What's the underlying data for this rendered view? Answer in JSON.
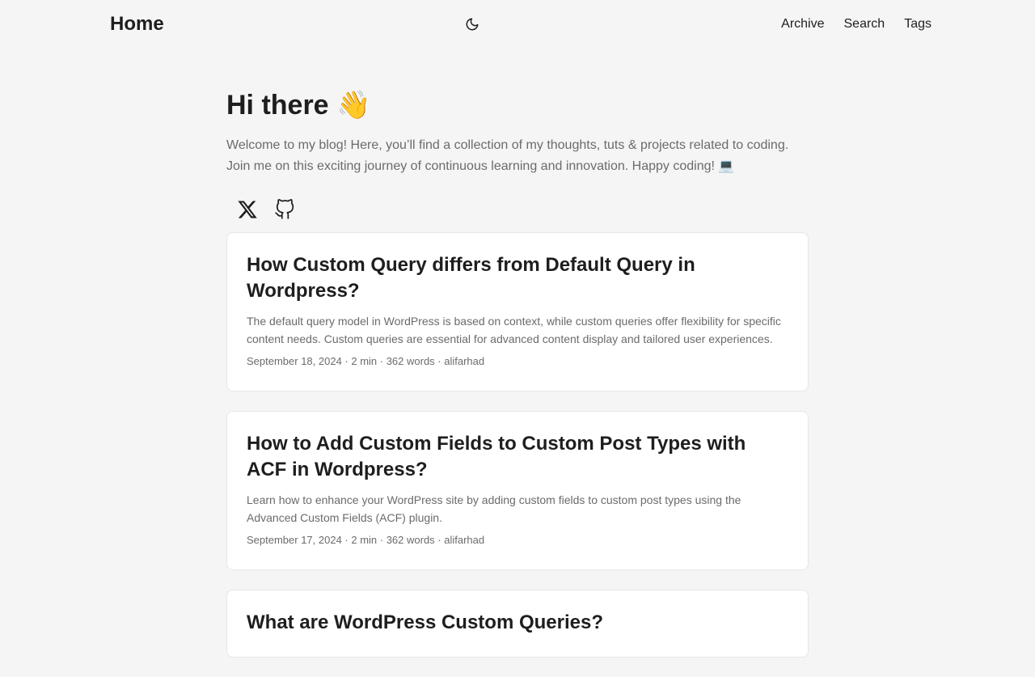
{
  "header": {
    "logo": "Home",
    "theme_toggle_icon": "moon-icon",
    "nav": [
      {
        "label": "Archive"
      },
      {
        "label": "Search"
      },
      {
        "label": "Tags"
      }
    ]
  },
  "hero": {
    "title": "Hi there 👋",
    "description": "Welcome to my blog! Here, you’ll find a collection of my thoughts, tuts & projects related to coding. Join me on this exciting journey of continuous learning and innovation. Happy coding! 💻",
    "social": [
      {
        "icon": "x-icon"
      },
      {
        "icon": "github-icon"
      }
    ]
  },
  "posts": [
    {
      "title": "How Custom Query differs from Default Query in Wordpress?",
      "summary": "The default query model in WordPress is based on context, while custom queries offer flexibility for specific content needs. Custom queries are essential for advanced content display and tailored user experiences.",
      "meta": "September 18, 2024 · 2 min · 362 words · alifarhad"
    },
    {
      "title": "How to Add Custom Fields to Custom Post Types with ACF in Wordpress?",
      "summary": "Learn how to enhance your WordPress site by adding custom fields to custom post types using the Advanced Custom Fields (ACF) plugin.",
      "meta": "September 17, 2024 · 2 min · 362 words · alifarhad"
    },
    {
      "title": "What are WordPress Custom Queries?",
      "summary": "",
      "meta": ""
    }
  ]
}
